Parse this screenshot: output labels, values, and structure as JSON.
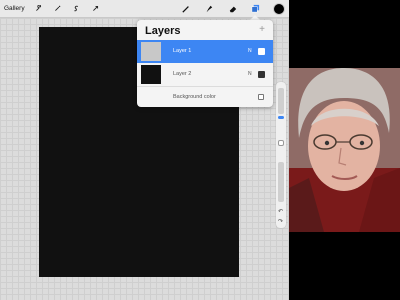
{
  "toolbar": {
    "gallery_label": "Gallery",
    "icons": [
      "wrench-icon",
      "magic-wand-icon",
      "selection-icon",
      "transform-icon",
      "brush-icon",
      "smudge-icon",
      "eraser-icon",
      "layers-icon",
      "color-icon"
    ],
    "active_color": "#000000"
  },
  "layers_panel": {
    "title": "Layers",
    "add_symbol": "+",
    "layers": [
      {
        "name": "Layer 1",
        "blend": "N",
        "visible": true,
        "selected": true,
        "thumb_color": "#c8c8c8"
      },
      {
        "name": "Layer 2",
        "blend": "N",
        "visible": true,
        "selected": false,
        "thumb_color": "#111111"
      }
    ],
    "background_label": "Background color",
    "accent": "#3d86f3"
  }
}
